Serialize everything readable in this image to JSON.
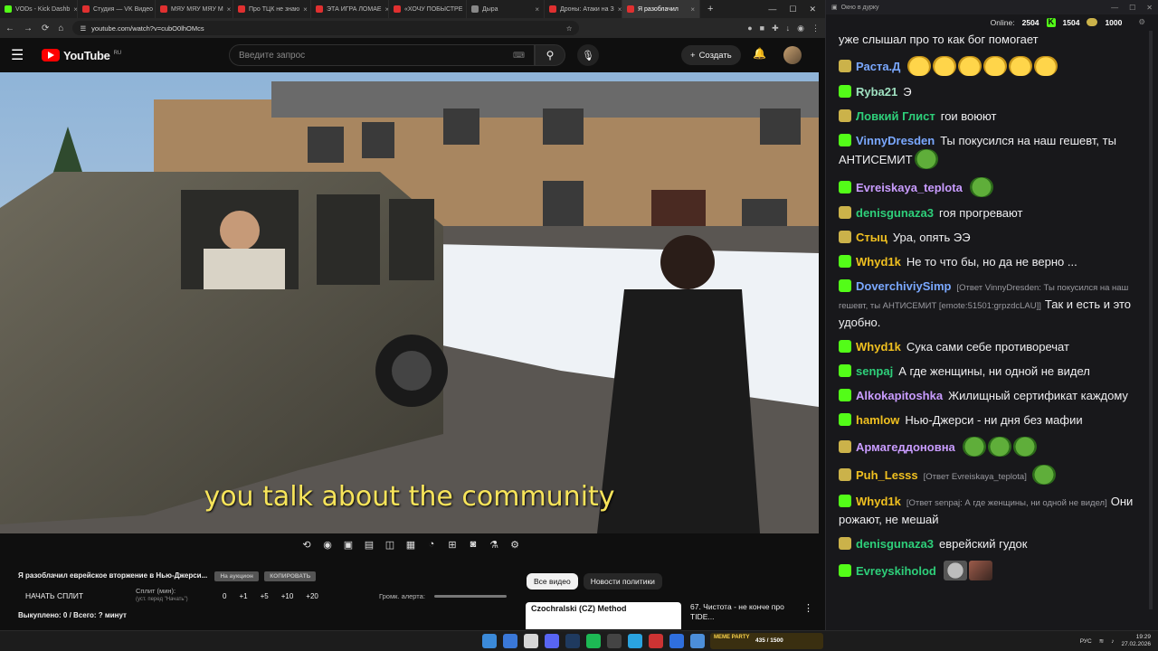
{
  "browser": {
    "tabs": [
      {
        "label": "VODs - Kick Dashb",
        "color": "#53fc18"
      },
      {
        "label": "Студия — VK Видео",
        "color": "#e03030"
      },
      {
        "label": "МЯУ МЯУ МЯУ М",
        "color": "#e03030"
      },
      {
        "label": "Про ТЦК не знаю",
        "color": "#e03030"
      },
      {
        "label": "ЭТА ИГРА ЛОМАЕ",
        "color": "#e03030"
      },
      {
        "label": "«ХОЧУ ПОБЫСТРЕ",
        "color": "#e03030"
      },
      {
        "label": "Дыра",
        "color": "#888"
      },
      {
        "label": "Дроны: Атаки на З",
        "color": "#e03030"
      },
      {
        "label": "Я разоблачил",
        "color": "#e03030"
      }
    ],
    "new_tab": "+",
    "url": "youtube.com/watch?v=cubO0lhOMcs"
  },
  "youtube": {
    "logo": "YouTube",
    "region": "RU",
    "search_placeholder": "Введите запрос",
    "create_label": "Создать",
    "caption": "you talk about the community",
    "video_title": "Я разоблачил еврейское вторжение в Нью-Джерси...",
    "tag1": "На аукцион",
    "tag2": "КОПИРОВАТЬ",
    "split_button": "НАЧАТЬ СПЛИТ",
    "split_label": "Сплит (мин):",
    "split_sub": "(уст. перед \"Начать\")",
    "split_values": [
      "0",
      "+1",
      "+5",
      "+10",
      "+20"
    ],
    "alert_label": "Громк. алерта:",
    "bought": "Выкуплено: 0 / Всего: ? минут",
    "chips": [
      "Все видео",
      "Новости политики"
    ],
    "reco_thumb_text": "Czochralski (CZ) Method",
    "reco_title": "67. Чистота - не конче про TIDE..."
  },
  "chat": {
    "window_title": "Окно в дурку",
    "online_label": "Online:",
    "online": "2504",
    "kick_count": "1504",
    "coin_count": "1000",
    "messages": [
      {
        "name": "",
        "color": "#efeff1",
        "badge": "",
        "text": "уже слышал про то как бог помогает",
        "reply": "",
        "emotes": []
      },
      {
        "name": "Раста.Д",
        "color": "#7aa8ff",
        "badge": "#cbb24a",
        "text": "",
        "reply": "",
        "emotes": [
          "laugh",
          "laugh",
          "laugh",
          "laugh",
          "laugh",
          "laugh"
        ]
      },
      {
        "name": "Ryba21",
        "color": "#9fe0c0",
        "badge": "#53fc18",
        "text": "Э",
        "reply": "",
        "emotes": []
      },
      {
        "name": "Ловкий Глист",
        "color": "#2ecf7a",
        "badge": "#cbb24a",
        "text": "гои воюют",
        "reply": "",
        "emotes": []
      },
      {
        "name": "VinnyDresden",
        "color": "#7aa8ff",
        "badge": "#53fc18",
        "text": "Ты покусился на наш гешевт, ты АНТИСЕМИТ",
        "reply": "",
        "emotes": [
          "pepe"
        ]
      },
      {
        "name": "Evreiskaya_teplota",
        "color": "#c99cff",
        "badge": "#53fc18",
        "text": "",
        "reply": "",
        "emotes": [
          "pepe"
        ]
      },
      {
        "name": "denisgunaza3",
        "color": "#2ecf7a",
        "badge": "#cbb24a",
        "text": "гоя прогревают",
        "reply": "",
        "emotes": []
      },
      {
        "name": "Стыц",
        "color": "#f0c020",
        "badge": "#cbb24a",
        "text": "Ура, опять ЭЭ",
        "reply": "",
        "emotes": []
      },
      {
        "name": "Whyd1k",
        "color": "#f0c020",
        "badge": "#53fc18",
        "text": "Не то что бы, но да не верно ...",
        "reply": "",
        "emotes": []
      },
      {
        "name": "DoverchiviySimp",
        "color": "#7aa8ff",
        "badge": "#53fc18",
        "text": "Так и есть и это удобно.",
        "reply": "[Ответ VinnyDresden: Ты покусился на наш гешевт, ты АНТИСЕМИТ [emote:51501:grpzdcLAU]]",
        "emotes": []
      },
      {
        "name": "Whyd1k",
        "color": "#f0c020",
        "badge": "#53fc18",
        "text": "Сука сами себе противоречат",
        "reply": "",
        "emotes": []
      },
      {
        "name": "senpaj",
        "color": "#2ecf7a",
        "badge": "#53fc18",
        "text": "А где женщины, ни одной не видел",
        "reply": "",
        "emotes": []
      },
      {
        "name": "Alkokapitoshka",
        "color": "#c99cff",
        "badge": "#53fc18",
        "text": "Жилищный сертификат каждому",
        "reply": "",
        "emotes": []
      },
      {
        "name": "hamlow",
        "color": "#f0c020",
        "badge": "#53fc18",
        "text": "Нью-Джерси - ни дня без мафии",
        "reply": "",
        "emotes": []
      },
      {
        "name": "Армагеддоновна",
        "color": "#c99cff",
        "badge": "#cbb24a",
        "text": "",
        "reply": "",
        "emotes": [
          "pepe",
          "pepe",
          "pepe"
        ]
      },
      {
        "name": "Puh_Lesss",
        "color": "#f0c020",
        "badge": "#cbb24a",
        "text": "",
        "reply": "[Ответ Evreiskaya_teplota]",
        "emotes": [
          "pepe"
        ]
      },
      {
        "name": "Whyd1k",
        "color": "#f0c020",
        "badge": "#53fc18",
        "text": "Они рожают, не мешай",
        "reply": "[Ответ senpaj: А где женщины, ни одной не видел]",
        "emotes": []
      },
      {
        "name": "denisgunaza3",
        "color": "#2ecf7a",
        "badge": "#cbb24a",
        "text": "еврейский гудок",
        "reply": "",
        "emotes": []
      },
      {
        "name": "Evreyskiholod",
        "color": "#2ecf7a",
        "badge": "#53fc18",
        "text": "",
        "reply": "",
        "emotes": [
          "cat",
          "photo"
        ]
      }
    ]
  },
  "taskbar": {
    "meme_label": "MEME PARTY",
    "meme_score": "435 / 1500",
    "lang": "РУС",
    "time": "19:29",
    "date": "27.02.2026",
    "icons": [
      "#3b8ad9",
      "#3a78d8",
      "#d6d6d6",
      "#5865f2",
      "#1f3a5f",
      "#1db954",
      "#444",
      "#2aa3e0",
      "#cc3333",
      "#2f6fde",
      "#4c8eda",
      "#e66a1f"
    ]
  }
}
